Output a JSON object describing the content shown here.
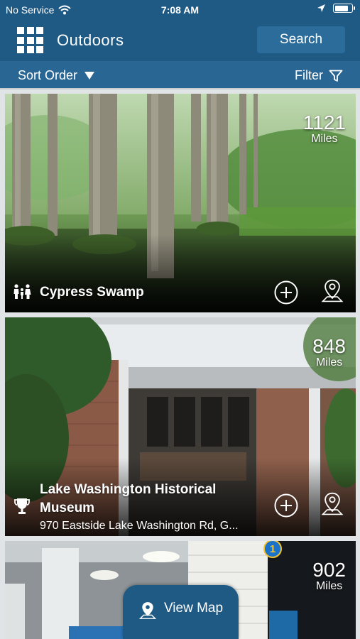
{
  "status_bar": {
    "carrier": "No Service",
    "time": "7:08 AM",
    "battery_level": 0.85
  },
  "header": {
    "title": "Outdoors",
    "search_label": "Search"
  },
  "toolbar": {
    "sort_label": "Sort Order",
    "filter_label": "Filter"
  },
  "cards": [
    {
      "name": "Cypress Swamp",
      "address": "",
      "distance": "1121",
      "unit": "Miles",
      "category_icon": "family-icon",
      "photo": "cypress swamp forest"
    },
    {
      "name": "Lake Washington Historical Museum",
      "address": "970 Eastside Lake Washington Rd, G...",
      "distance": "848",
      "unit": "Miles",
      "category_icon": "museum-trophy-icon",
      "photo": "brick museum building"
    },
    {
      "name": "",
      "address": "",
      "distance": "902",
      "unit": "Miles",
      "category_icon": "",
      "photo": "interior station with columns",
      "badge": "1"
    }
  ],
  "view_map": {
    "label": "View Map"
  },
  "colors": {
    "header": "#1f5a85",
    "subbar": "#2a6694",
    "search_button": "#2b6c9a"
  }
}
